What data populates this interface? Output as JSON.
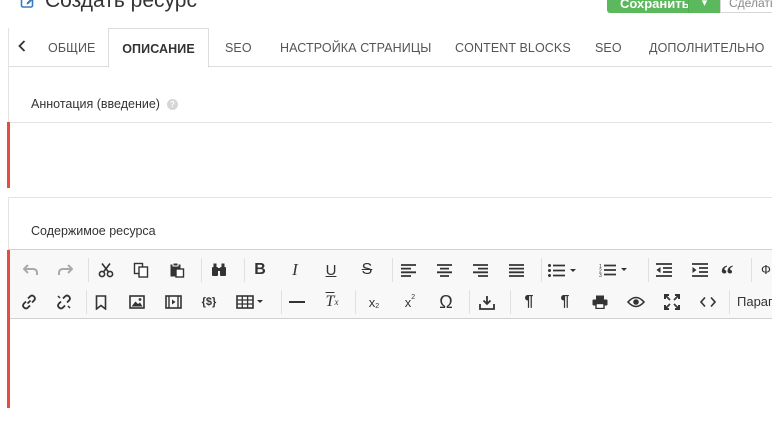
{
  "header": {
    "title": "Создать ресурс",
    "save_label": "Сохранить",
    "second_action": "Сделать"
  },
  "tabs": [
    {
      "label": "ОБЩИЕ",
      "active": false
    },
    {
      "label": "ОПИСАНИЕ",
      "active": true
    },
    {
      "label": "SEO",
      "active": false
    },
    {
      "label": "НАСТРОЙКА СТРАНИЦЫ",
      "active": false
    },
    {
      "label": "CONTENT BLOCKS",
      "active": false
    },
    {
      "label": "SEO",
      "active": false
    },
    {
      "label": "ДОПОЛНИТЕЛЬНО",
      "active": false
    }
  ],
  "fields": {
    "annotation_label": "Аннотация (введение)",
    "annotation_help": "?",
    "content_label": "Содержимое ресурса"
  },
  "editor": {
    "format_select_partial": "Ф",
    "paragraph_select": "Параграф"
  },
  "colors": {
    "accent_green": "#5cb85c",
    "required_marker": "#e74c3c",
    "toolbar_bg": "#f8f8f8"
  },
  "icons": {
    "title": "edit-icon",
    "tabs_prev": "chevron-left-icon",
    "toolbar_row1": [
      "undo-icon",
      "redo-icon",
      "cut-icon",
      "copy-icon",
      "paste-icon",
      "find-icon",
      "bold-icon",
      "italic-icon",
      "underline-icon",
      "strikethrough-icon",
      "align-left-icon",
      "align-center-icon",
      "align-right-icon",
      "align-justify-icon",
      "bullet-list-icon",
      "numbered-list-icon",
      "outdent-icon",
      "indent-icon",
      "blockquote-icon"
    ],
    "toolbar_row2": [
      "link-icon",
      "unlink-icon",
      "bookmark-icon",
      "image-icon",
      "media-icon",
      "template-icon",
      "table-icon",
      "horizontal-rule-icon",
      "clear-format-icon",
      "subscript-icon",
      "superscript-icon",
      "special-char-icon",
      "insert-icon",
      "show-blocks-icon",
      "paragraph-icon",
      "print-icon",
      "preview-icon",
      "fullscreen-icon",
      "source-code-icon"
    ]
  }
}
